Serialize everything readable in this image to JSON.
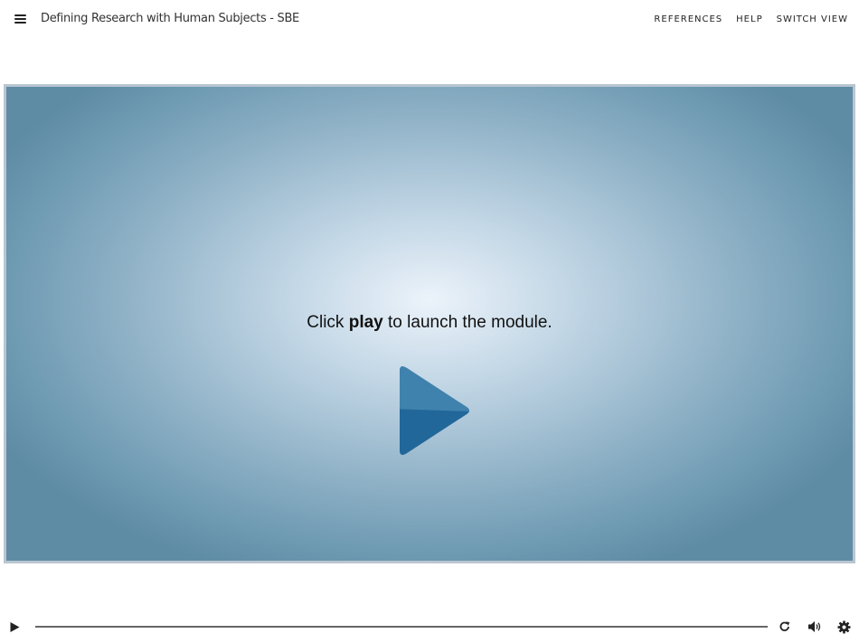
{
  "header": {
    "title": "Defining Research with Human Subjects - SBE",
    "nav": [
      "REFERENCES",
      "HELP",
      "SWITCH VIEW"
    ]
  },
  "stage": {
    "prompt_before": "Click ",
    "prompt_bold": "play",
    "prompt_after": " to launch the module.",
    "play_color": "#2b6e9c"
  },
  "controls": {
    "progress": 0,
    "icons": [
      "play-icon",
      "replay-icon",
      "volume-icon",
      "settings-icon"
    ]
  }
}
